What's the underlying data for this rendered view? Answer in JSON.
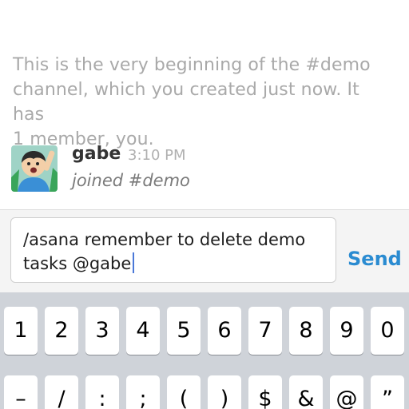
{
  "channel_intro": {
    "line1": "This is the very beginning of the #demo",
    "line2": "channel, which you created just now. It has",
    "line3": "1 member, you."
  },
  "message": {
    "author": "gabe",
    "time": "3:10 PM",
    "text": "joined #demo"
  },
  "composer": {
    "text_line1": "/asana remember to delete demo",
    "text_line2": "tasks @gabe",
    "send_label": "Send"
  },
  "keyboard": {
    "row1": [
      "1",
      "2",
      "3",
      "4",
      "5",
      "6",
      "7",
      "8",
      "9",
      "0"
    ],
    "row2": [
      "–",
      "/",
      ":",
      ";",
      "(",
      ")",
      "$",
      "&",
      "@",
      "”"
    ]
  }
}
